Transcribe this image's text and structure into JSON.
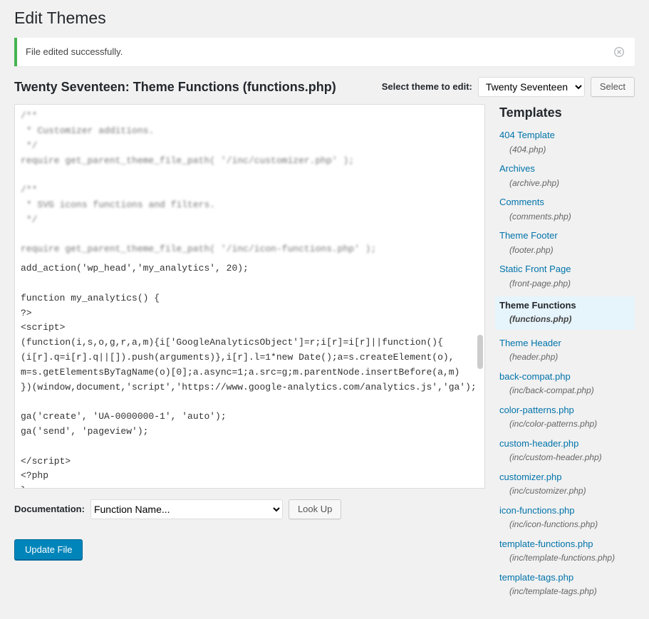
{
  "page": {
    "title": "Edit Themes",
    "notice": "File edited successfully.",
    "file_heading": "Twenty Seventeen: Theme Functions (functions.php)",
    "select_label": "Select theme to edit:",
    "selected_theme": "Twenty Seventeen",
    "select_button": "Select",
    "doc_label": "Documentation:",
    "doc_placeholder": "Function Name...",
    "lookup_button": "Look Up",
    "update_button": "Update File",
    "templates_heading": "Templates"
  },
  "templates": [
    {
      "label": "404 Template",
      "file": "(404.php)"
    },
    {
      "label": "Archives",
      "file": "(archive.php)"
    },
    {
      "label": "Comments",
      "file": "(comments.php)"
    },
    {
      "label": "Theme Footer",
      "file": "(footer.php)"
    },
    {
      "label": "Static Front Page",
      "file": "(front-page.php)"
    },
    {
      "label": "Theme Functions",
      "file": "(functions.php)",
      "current": true
    },
    {
      "label": "Theme Header",
      "file": "(header.php)"
    },
    {
      "label": "back-compat.php",
      "file": "(inc/back-compat.php)"
    },
    {
      "label": "color-patterns.php",
      "file": "(inc/color-patterns.php)"
    },
    {
      "label": "custom-header.php",
      "file": "(inc/custom-header.php)"
    },
    {
      "label": "customizer.php",
      "file": "(inc/customizer.php)"
    },
    {
      "label": "icon-functions.php",
      "file": "(inc/icon-functions.php)"
    },
    {
      "label": "template-functions.php",
      "file": "(inc/template-functions.php)"
    },
    {
      "label": "template-tags.php",
      "file": "(inc/template-tags.php)"
    }
  ],
  "editor": {
    "blurred_lines": "/**\n * Customizer additions.\n */\nrequire get_parent_theme_file_path( '/inc/customizer.php' );\n\n/**\n * SVG icons functions and filters.\n */\n\nrequire get_parent_theme_file_path( '/inc/icon-functions.php' );",
    "clear_lines": "add_action('wp_head','my_analytics', 20);\n\nfunction my_analytics() {\n?>\n<script>\n(function(i,s,o,g,r,a,m){i['GoogleAnalyticsObject']=r;i[r]=i[r]||function(){\n(i[r].q=i[r].q||[]).push(arguments)},i[r].l=1*new Date();a=s.createElement(o),\nm=s.getElementsByTagName(o)[0];a.async=1;a.src=g;m.parentNode.insertBefore(a,m)\n})(window,document,'script','https://www.google-analytics.com/analytics.js','ga');\n\nga('create', 'UA-0000000-1', 'auto');\nga('send', 'pageview');\n\n</script>\n<?php\n}"
  }
}
